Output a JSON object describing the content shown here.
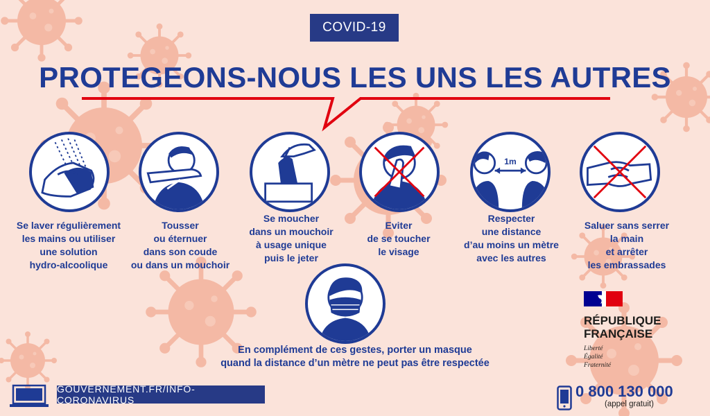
{
  "badge": "COVID-19",
  "headline": "PROTEGEONS-NOUS LES UNS LES AUTRES",
  "gestures": [
    {
      "icon": "hand-washing-icon",
      "lines": [
        "Se laver régulièrement",
        "les mains ou utiliser",
        "une solution",
        "hydro-alcoolique"
      ]
    },
    {
      "icon": "sneeze-elbow-icon",
      "lines": [
        "Tousser",
        "ou éternuer",
        "dans son coude",
        "ou dans un mouchoir"
      ]
    },
    {
      "icon": "tissue-icon",
      "lines": [
        "Se moucher",
        "dans un mouchoir",
        "à usage unique",
        "puis le jeter"
      ]
    },
    {
      "icon": "no-face-touch-icon",
      "lines": [
        "Eviter",
        "de se toucher",
        "le visage"
      ]
    },
    {
      "icon": "distance-icon",
      "distance_label": "1m",
      "lines": [
        "Respecter",
        "une distance",
        "d’au moins un mètre",
        "avec les autres"
      ]
    },
    {
      "icon": "no-handshake-icon",
      "lines": [
        "Saluer sans serrer",
        "la main",
        "et arrêter",
        "les embrassades"
      ]
    }
  ],
  "mask": {
    "icon": "mask-icon",
    "lines": [
      "En complément de ces gestes, porter un masque",
      "quand la distance d’un mètre ne peut pas être respectée"
    ]
  },
  "republique": {
    "name_lines": [
      "RÉPUBLIQUE",
      "FRANÇAISE"
    ],
    "motto": [
      "Liberté",
      "Égalité",
      "Fraternité"
    ]
  },
  "footer": {
    "url": "GOUVERNEMENT.FR/INFO-CORONAVIRUS",
    "phone": "0 800 130 000",
    "phone_note": "(appel gratuit)"
  },
  "colors": {
    "navy": "#1f3b95",
    "red": "#e1000f",
    "background": "#fbe3da",
    "virus": "#f4b9a5"
  }
}
